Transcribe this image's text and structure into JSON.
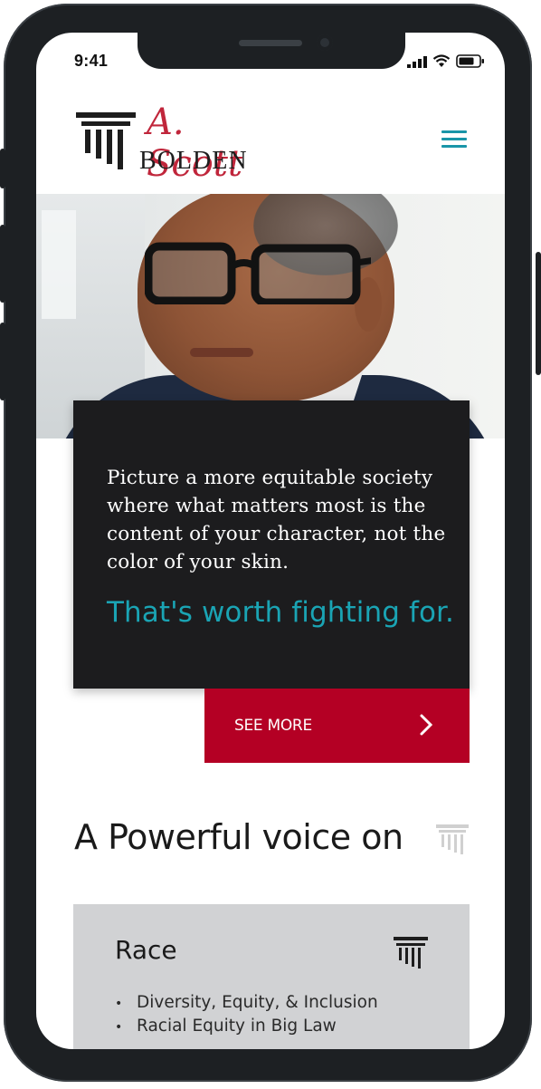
{
  "status_bar": {
    "time": "9:41"
  },
  "header": {
    "logo_script": "A. Scott",
    "logo_name": "BOLDEN",
    "menu_icon": "hamburger-menu-icon"
  },
  "hero": {
    "photo": "portrait-photo"
  },
  "quote": {
    "text": "Picture a more equitable society where what matters most is the content of your character, not the color of your skin.",
    "emphasis": "That's worth fighting for."
  },
  "see_more": {
    "label": "SEE MORE",
    "icon": "chevron-right-icon"
  },
  "voice": {
    "title": "A Powerful voice on",
    "icon": "pillar-icon"
  },
  "race": {
    "title": "Race",
    "icon": "pillar-icon",
    "items": [
      "Diversity, Equity, & Inclusion",
      "Racial Equity in Big Law"
    ]
  },
  "colors": {
    "brand_red": "#b40024",
    "accent_teal": "#1aa4b4",
    "card_dark": "#1c1c1e",
    "card_gray": "#d1d2d4"
  }
}
